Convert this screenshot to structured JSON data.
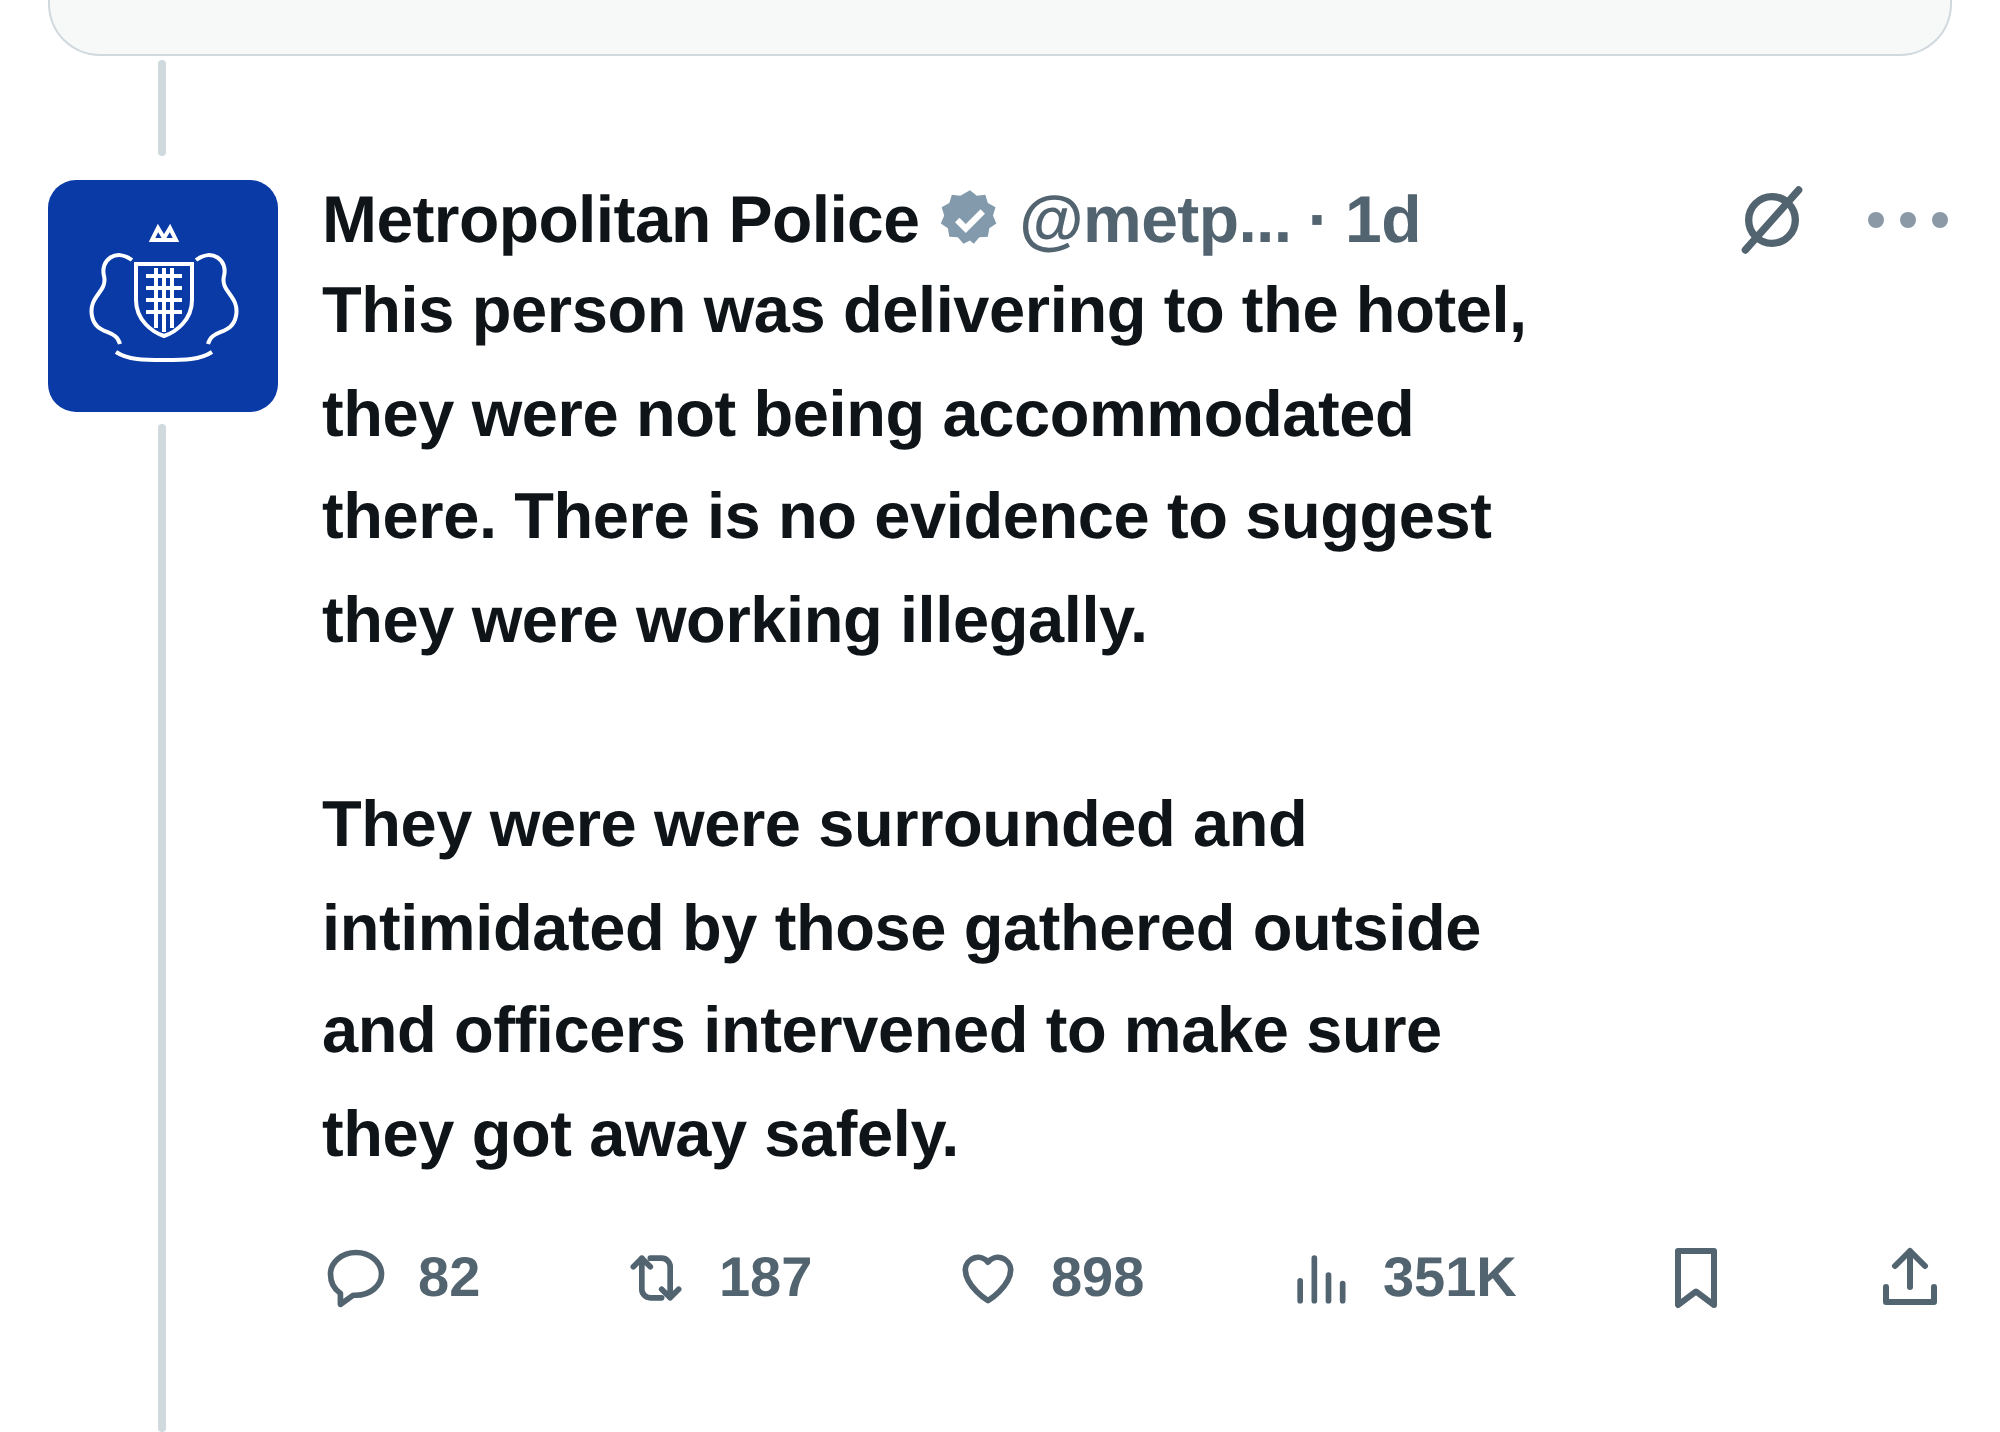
{
  "post": {
    "author": "Metropolitan Police",
    "verified": true,
    "handle": "@metp...",
    "separator": "·",
    "time": "1d",
    "paragraphs": [
      "This person was delivering to the hotel,\nthey were not being accommodated\nthere. There is no evidence to suggest\nthey were working illegally.",
      "They were were surrounded and\nintimidated by those gathered outside\nand officers intervened to make sure\nthey got away safely."
    ],
    "actions": [
      {
        "kind": "reply",
        "count": "82"
      },
      {
        "kind": "repost",
        "count": "187"
      },
      {
        "kind": "like",
        "count": "898"
      },
      {
        "kind": "views",
        "count": "351K"
      },
      {
        "kind": "bookmark"
      },
      {
        "kind": "share"
      }
    ]
  }
}
